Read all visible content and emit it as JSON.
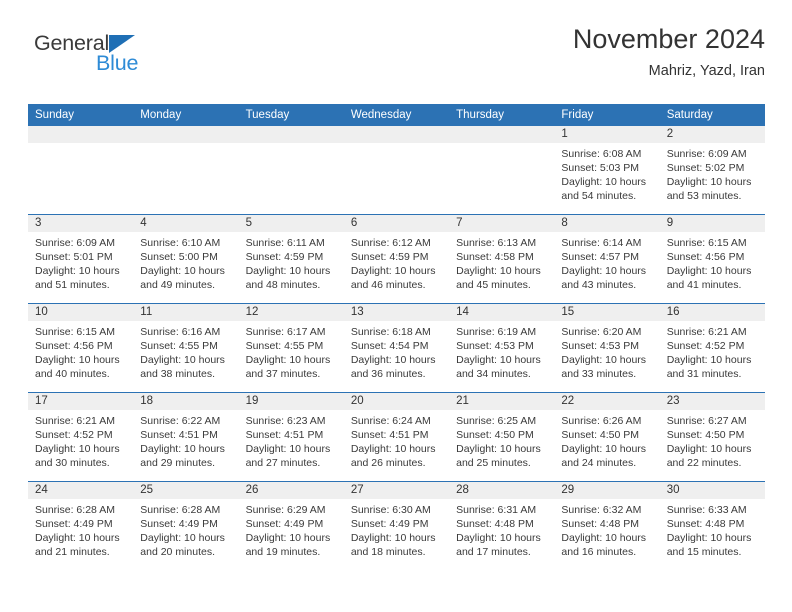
{
  "brand": {
    "name_line1": "General",
    "name_line2": "Blue",
    "accent_color": "#2C72B4",
    "logo_blue": "#2E8BD6"
  },
  "header": {
    "title": "November 2024",
    "subtitle": "Mahriz, Yazd, Iran"
  },
  "calendar": {
    "weekday_headers": [
      "Sunday",
      "Monday",
      "Tuesday",
      "Wednesday",
      "Thursday",
      "Friday",
      "Saturday"
    ],
    "header_bg": "#2C72B4",
    "date_band_bg": "#EFEFEF",
    "weeks": [
      [
        {
          "date": "",
          "lines": []
        },
        {
          "date": "",
          "lines": []
        },
        {
          "date": "",
          "lines": []
        },
        {
          "date": "",
          "lines": []
        },
        {
          "date": "",
          "lines": []
        },
        {
          "date": "1",
          "lines": [
            "Sunrise: 6:08 AM",
            "Sunset: 5:03 PM",
            "Daylight: 10 hours",
            "and 54 minutes."
          ]
        },
        {
          "date": "2",
          "lines": [
            "Sunrise: 6:09 AM",
            "Sunset: 5:02 PM",
            "Daylight: 10 hours",
            "and 53 minutes."
          ]
        }
      ],
      [
        {
          "date": "3",
          "lines": [
            "Sunrise: 6:09 AM",
            "Sunset: 5:01 PM",
            "Daylight: 10 hours",
            "and 51 minutes."
          ]
        },
        {
          "date": "4",
          "lines": [
            "Sunrise: 6:10 AM",
            "Sunset: 5:00 PM",
            "Daylight: 10 hours",
            "and 49 minutes."
          ]
        },
        {
          "date": "5",
          "lines": [
            "Sunrise: 6:11 AM",
            "Sunset: 4:59 PM",
            "Daylight: 10 hours",
            "and 48 minutes."
          ]
        },
        {
          "date": "6",
          "lines": [
            "Sunrise: 6:12 AM",
            "Sunset: 4:59 PM",
            "Daylight: 10 hours",
            "and 46 minutes."
          ]
        },
        {
          "date": "7",
          "lines": [
            "Sunrise: 6:13 AM",
            "Sunset: 4:58 PM",
            "Daylight: 10 hours",
            "and 45 minutes."
          ]
        },
        {
          "date": "8",
          "lines": [
            "Sunrise: 6:14 AM",
            "Sunset: 4:57 PM",
            "Daylight: 10 hours",
            "and 43 minutes."
          ]
        },
        {
          "date": "9",
          "lines": [
            "Sunrise: 6:15 AM",
            "Sunset: 4:56 PM",
            "Daylight: 10 hours",
            "and 41 minutes."
          ]
        }
      ],
      [
        {
          "date": "10",
          "lines": [
            "Sunrise: 6:15 AM",
            "Sunset: 4:56 PM",
            "Daylight: 10 hours",
            "and 40 minutes."
          ]
        },
        {
          "date": "11",
          "lines": [
            "Sunrise: 6:16 AM",
            "Sunset: 4:55 PM",
            "Daylight: 10 hours",
            "and 38 minutes."
          ]
        },
        {
          "date": "12",
          "lines": [
            "Sunrise: 6:17 AM",
            "Sunset: 4:55 PM",
            "Daylight: 10 hours",
            "and 37 minutes."
          ]
        },
        {
          "date": "13",
          "lines": [
            "Sunrise: 6:18 AM",
            "Sunset: 4:54 PM",
            "Daylight: 10 hours",
            "and 36 minutes."
          ]
        },
        {
          "date": "14",
          "lines": [
            "Sunrise: 6:19 AM",
            "Sunset: 4:53 PM",
            "Daylight: 10 hours",
            "and 34 minutes."
          ]
        },
        {
          "date": "15",
          "lines": [
            "Sunrise: 6:20 AM",
            "Sunset: 4:53 PM",
            "Daylight: 10 hours",
            "and 33 minutes."
          ]
        },
        {
          "date": "16",
          "lines": [
            "Sunrise: 6:21 AM",
            "Sunset: 4:52 PM",
            "Daylight: 10 hours",
            "and 31 minutes."
          ]
        }
      ],
      [
        {
          "date": "17",
          "lines": [
            "Sunrise: 6:21 AM",
            "Sunset: 4:52 PM",
            "Daylight: 10 hours",
            "and 30 minutes."
          ]
        },
        {
          "date": "18",
          "lines": [
            "Sunrise: 6:22 AM",
            "Sunset: 4:51 PM",
            "Daylight: 10 hours",
            "and 29 minutes."
          ]
        },
        {
          "date": "19",
          "lines": [
            "Sunrise: 6:23 AM",
            "Sunset: 4:51 PM",
            "Daylight: 10 hours",
            "and 27 minutes."
          ]
        },
        {
          "date": "20",
          "lines": [
            "Sunrise: 6:24 AM",
            "Sunset: 4:51 PM",
            "Daylight: 10 hours",
            "and 26 minutes."
          ]
        },
        {
          "date": "21",
          "lines": [
            "Sunrise: 6:25 AM",
            "Sunset: 4:50 PM",
            "Daylight: 10 hours",
            "and 25 minutes."
          ]
        },
        {
          "date": "22",
          "lines": [
            "Sunrise: 6:26 AM",
            "Sunset: 4:50 PM",
            "Daylight: 10 hours",
            "and 24 minutes."
          ]
        },
        {
          "date": "23",
          "lines": [
            "Sunrise: 6:27 AM",
            "Sunset: 4:50 PM",
            "Daylight: 10 hours",
            "and 22 minutes."
          ]
        }
      ],
      [
        {
          "date": "24",
          "lines": [
            "Sunrise: 6:28 AM",
            "Sunset: 4:49 PM",
            "Daylight: 10 hours",
            "and 21 minutes."
          ]
        },
        {
          "date": "25",
          "lines": [
            "Sunrise: 6:28 AM",
            "Sunset: 4:49 PM",
            "Daylight: 10 hours",
            "and 20 minutes."
          ]
        },
        {
          "date": "26",
          "lines": [
            "Sunrise: 6:29 AM",
            "Sunset: 4:49 PM",
            "Daylight: 10 hours",
            "and 19 minutes."
          ]
        },
        {
          "date": "27",
          "lines": [
            "Sunrise: 6:30 AM",
            "Sunset: 4:49 PM",
            "Daylight: 10 hours",
            "and 18 minutes."
          ]
        },
        {
          "date": "28",
          "lines": [
            "Sunrise: 6:31 AM",
            "Sunset: 4:48 PM",
            "Daylight: 10 hours",
            "and 17 minutes."
          ]
        },
        {
          "date": "29",
          "lines": [
            "Sunrise: 6:32 AM",
            "Sunset: 4:48 PM",
            "Daylight: 10 hours",
            "and 16 minutes."
          ]
        },
        {
          "date": "30",
          "lines": [
            "Sunrise: 6:33 AM",
            "Sunset: 4:48 PM",
            "Daylight: 10 hours",
            "and 15 minutes."
          ]
        }
      ]
    ]
  }
}
